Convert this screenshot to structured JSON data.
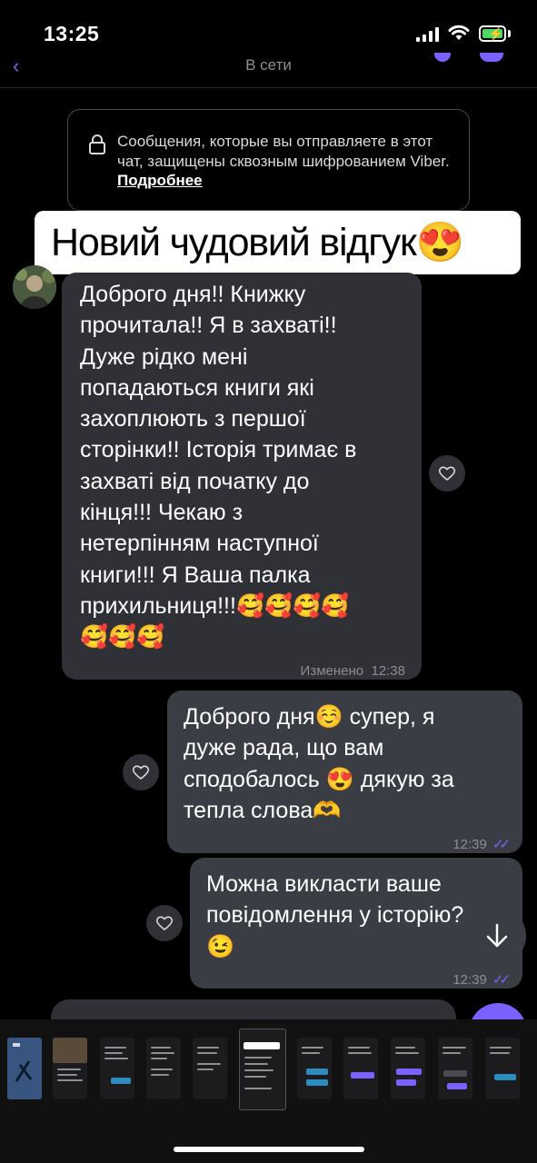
{
  "status_bar": {
    "time": "13:25"
  },
  "header": {
    "subtitle": "В сети"
  },
  "e2e_notice": {
    "text": "Сообщения, которые вы отправляете в этот чат, защищены сквозным шифрованием Viber. ",
    "link": "Подробнее"
  },
  "overlay_caption": "Новий чудовий відгук😍",
  "messages": [
    {
      "direction": "incoming",
      "text": "Доброго дня!! Книжку\nпрочитала!! Я в захваті!!\nДуже рідко мені\nпопадаються книги які\nзахоплюють з першої\nсторінки!! Історія тримає в\nзахваті від початку до\nкінця!!! Чекаю з\nнетерпінням наступної\nкниги!!! Я Ваша палка\nприхильниця!!!🥰🥰🥰🥰\n🥰🥰🥰",
      "edited": "Изменено",
      "time": "12:38"
    },
    {
      "direction": "outgoing",
      "text": "Доброго дня☺️ супер, я\nдуже рада, що вам\nсподобалось 😍 дякую за\nтепла слова🫶",
      "time": "12:39"
    },
    {
      "direction": "outgoing",
      "text": "Можна викласти ваше\nповідомлення у історію?\n😉",
      "time": "12:39"
    }
  ],
  "colors": {
    "accent": "#7b61ff",
    "incoming_bubble": "#2f3136",
    "outgoing_bubble": "#3a3d43",
    "background": "#000000"
  },
  "icons": [
    "lock-icon",
    "heart-icon",
    "arrow-down-icon",
    "double-check-icon",
    "signal-icon",
    "wifi-icon",
    "battery-icon"
  ]
}
